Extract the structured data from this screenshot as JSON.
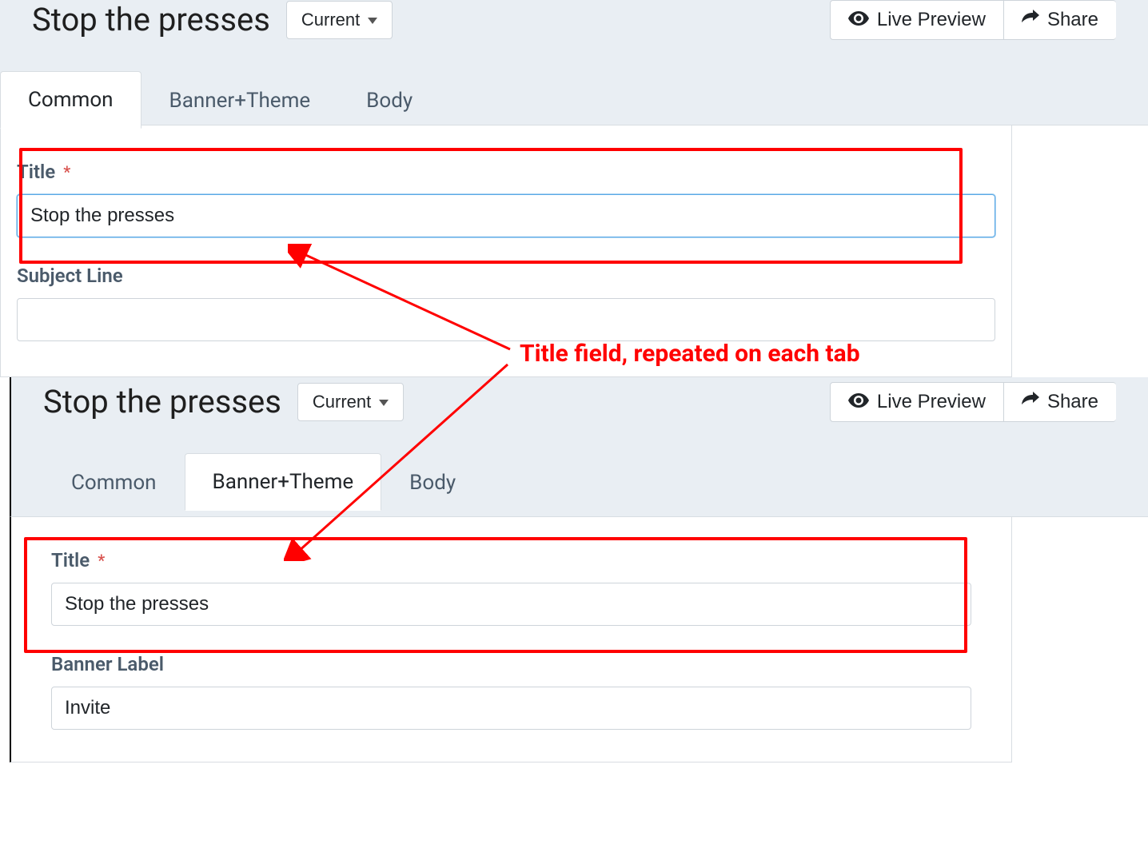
{
  "top": {
    "title": "Stop the presses",
    "status_label": "Current",
    "actions": {
      "preview": "Live Preview",
      "share": "Share"
    },
    "tabs": [
      "Common",
      "Banner+Theme",
      "Body"
    ],
    "active_tab": 0,
    "fields": {
      "title_label": "Title",
      "title_value": "Stop the presses",
      "subject_label": "Subject Line",
      "subject_value": ""
    }
  },
  "bottom": {
    "title": "Stop the presses",
    "status_label": "Current",
    "actions": {
      "preview": "Live Preview",
      "share": "Share"
    },
    "tabs": [
      "Common",
      "Banner+Theme",
      "Body"
    ],
    "active_tab": 1,
    "fields": {
      "title_label": "Title",
      "title_value": "Stop the presses",
      "banner_label": "Banner Label",
      "banner_value": "Invite"
    }
  },
  "annotation": "Title field, repeated on each tab",
  "required_mark": "*"
}
